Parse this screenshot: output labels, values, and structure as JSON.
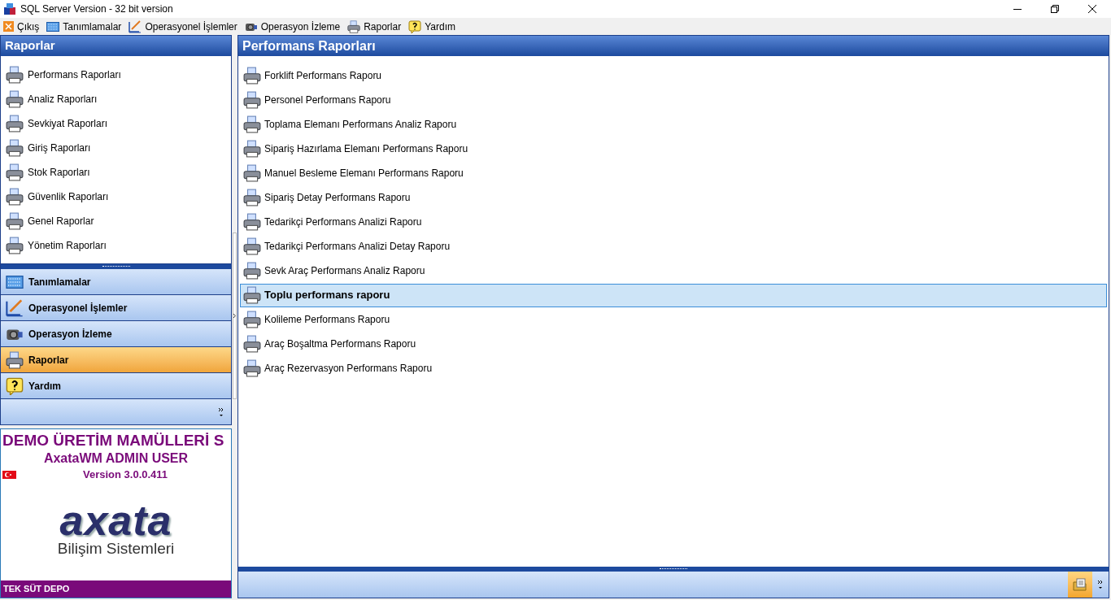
{
  "window": {
    "title": "SQL Server Version - 32 bit version"
  },
  "menu": [
    {
      "label": "Çıkış"
    },
    {
      "label": "Tanımlamalar"
    },
    {
      "label": "Operasyonel İşlemler"
    },
    {
      "label": "Operasyon İzleme"
    },
    {
      "label": "Raporlar"
    },
    {
      "label": "Yardım"
    }
  ],
  "sidebar": {
    "title": "Raporlar",
    "items": [
      {
        "label": "Performans Raporları"
      },
      {
        "label": "Analiz Raporları"
      },
      {
        "label": "Sevkiyat Raporları"
      },
      {
        "label": "Giriş Raporları"
      },
      {
        "label": "Stok Raporları"
      },
      {
        "label": "Güvenlik Raporları"
      },
      {
        "label": "Genel Raporlar"
      },
      {
        "label": "Yönetim Raporları"
      }
    ],
    "sections": [
      {
        "label": "Tanımlamalar",
        "selected": false
      },
      {
        "label": "Operasyonel İşlemler",
        "selected": false
      },
      {
        "label": "Operasyon İzleme",
        "selected": false
      },
      {
        "label": "Raporlar",
        "selected": true
      },
      {
        "label": "Yardım",
        "selected": false
      }
    ]
  },
  "info": {
    "company": "DEMO ÜRETİM MAMÜLLERİ S",
    "user": "AxataWM ADMIN USER",
    "version": "Version 3.0.0.411",
    "logo": "axata",
    "logo_subtitle": "Bilişim Sistemleri",
    "warehouse": "TEK SÜT DEPO"
  },
  "main": {
    "title": "Performans Raporları",
    "items": [
      {
        "label": "Forklift Performans Raporu",
        "selected": false
      },
      {
        "label": "Personel Performans Raporu",
        "selected": false
      },
      {
        "label": "Toplama Elemanı Performans Analiz Raporu",
        "selected": false
      },
      {
        "label": "Sipariş Hazırlama Elemanı Performans Raporu",
        "selected": false
      },
      {
        "label": "Manuel Besleme Elemanı Performans Raporu",
        "selected": false
      },
      {
        "label": "Sipariş Detay Performans Raporu",
        "selected": false
      },
      {
        "label": "Tedarikçi Performans Analizi Raporu",
        "selected": false
      },
      {
        "label": "Tedarikçi Performans Analizi Detay Raporu",
        "selected": false
      },
      {
        "label": "Sevk Araç Performans Analiz Raporu",
        "selected": false
      },
      {
        "label": "Toplu performans raporu",
        "selected": true
      },
      {
        "label": "Kolileme Performans Raporu",
        "selected": false
      },
      {
        "label": "Araç Boşaltma Performans Raporu",
        "selected": false
      },
      {
        "label": "Araç Rezervasyon Performans Raporu",
        "selected": false
      }
    ]
  }
}
